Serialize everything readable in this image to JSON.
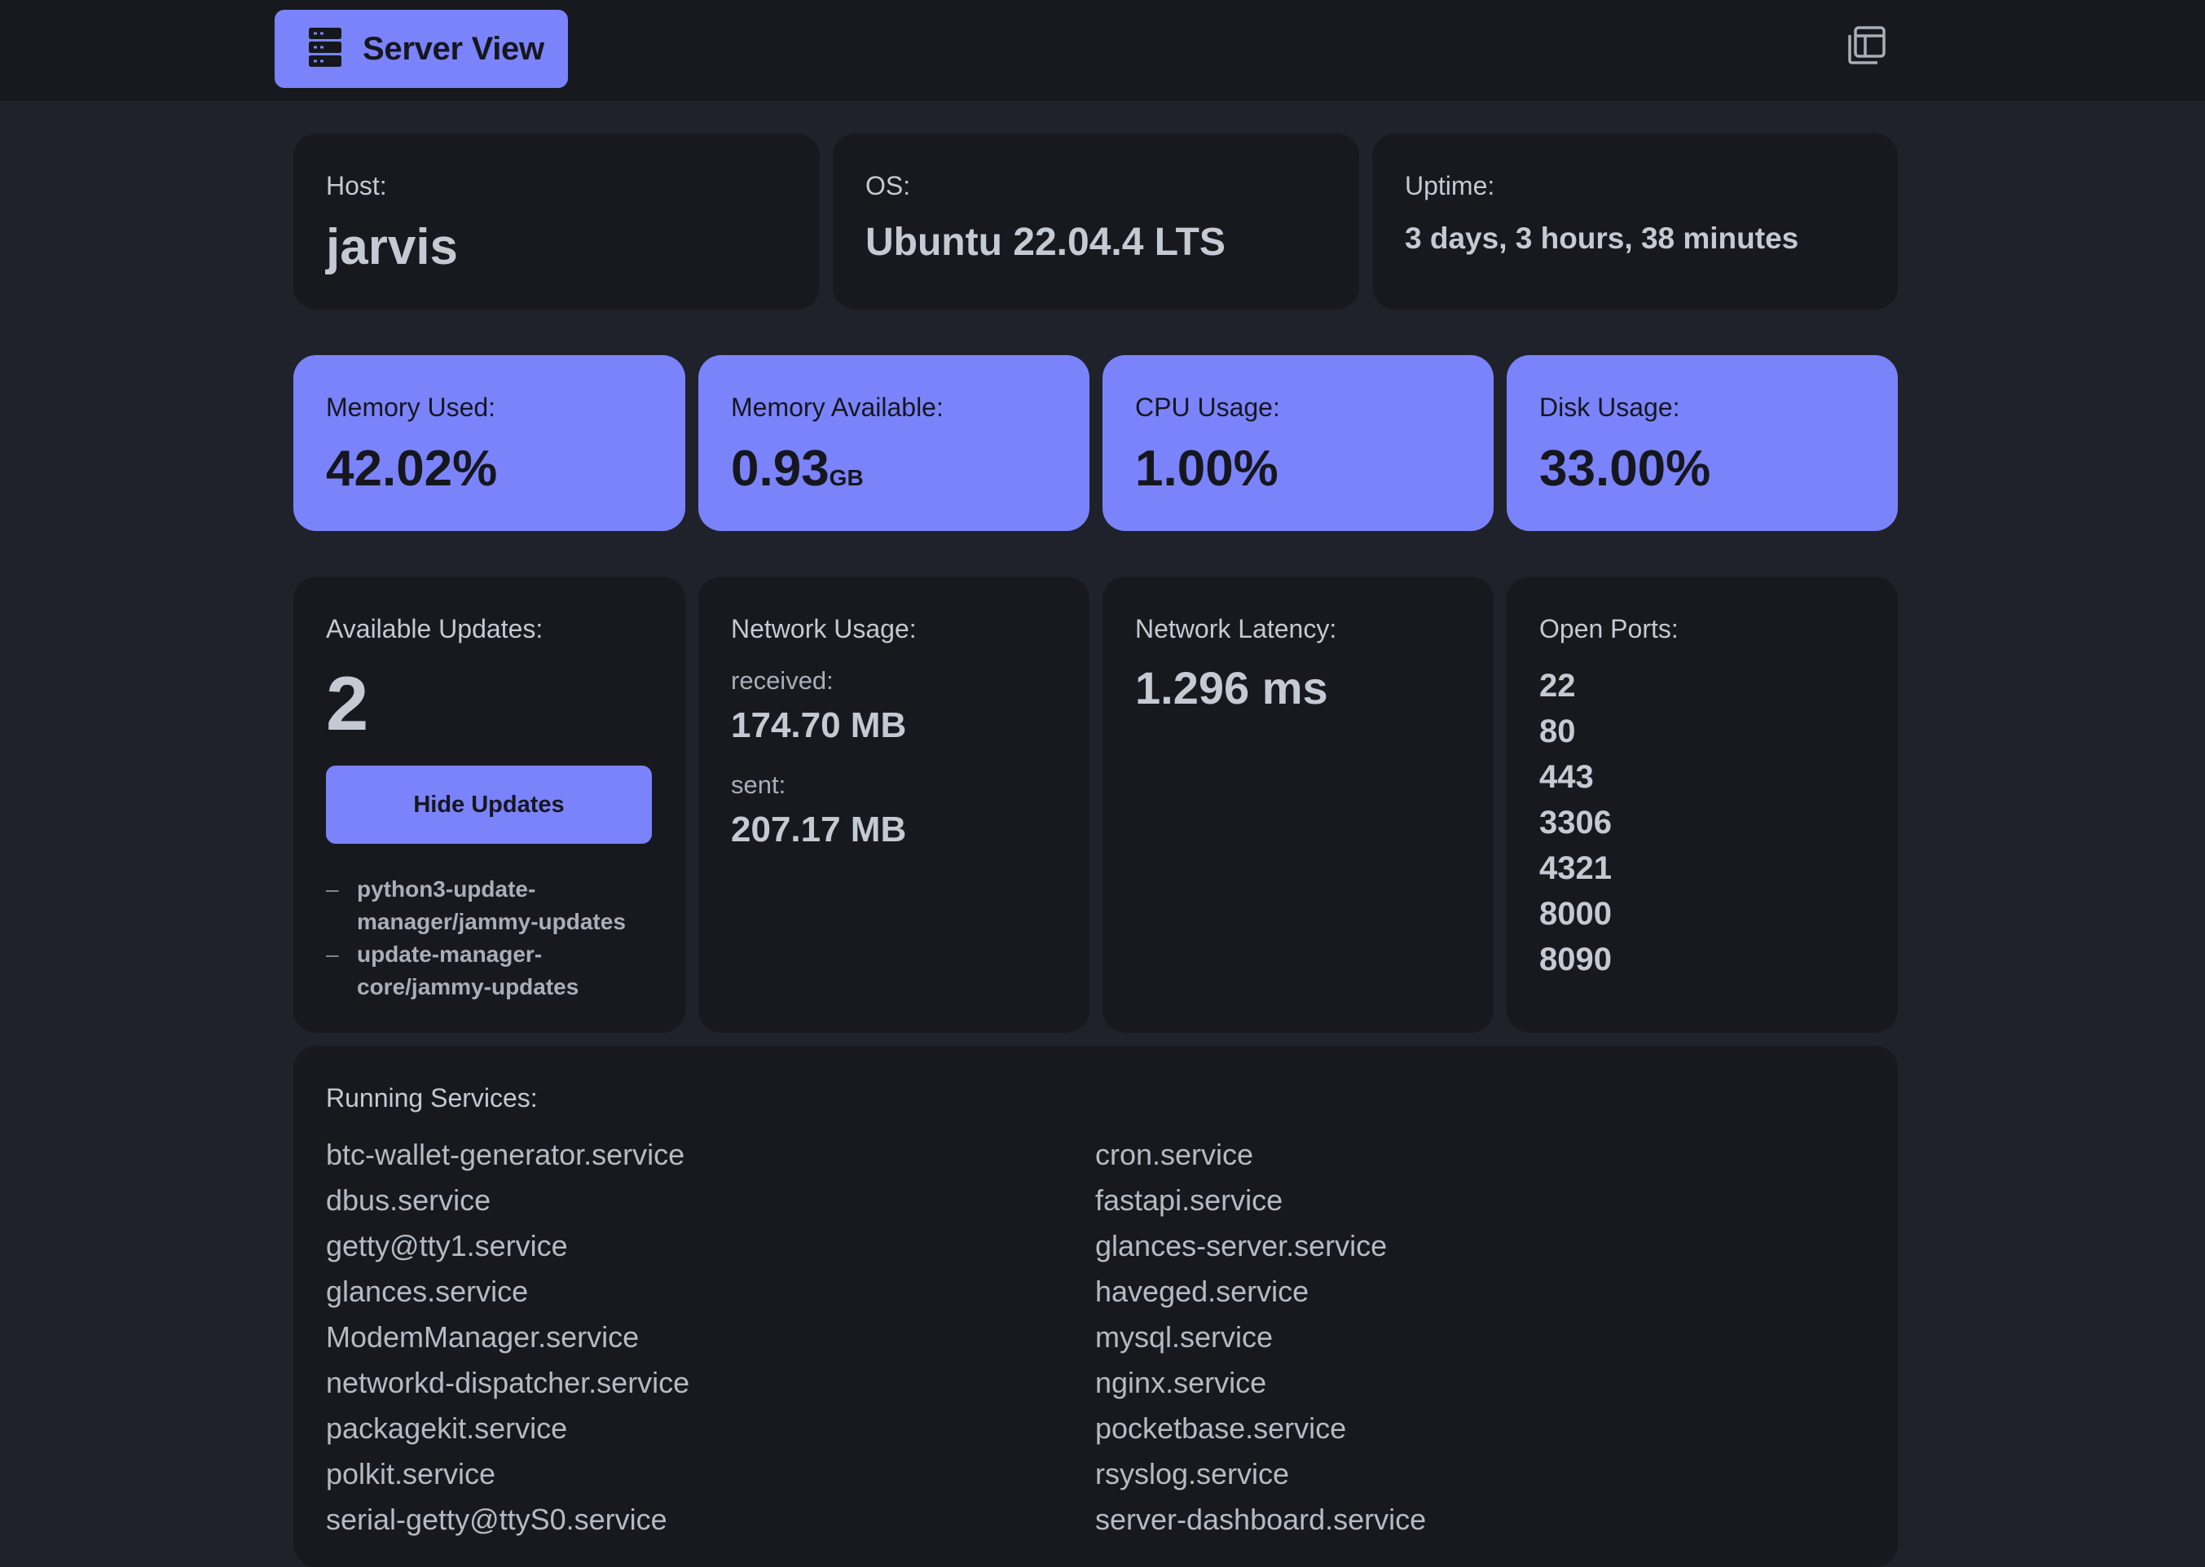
{
  "header": {
    "title": "Server View",
    "brand_icon": "server-icon",
    "window_icon": "window-restore-icon"
  },
  "colors": {
    "background": "#1f222a",
    "card": "#17191e",
    "accent": "#7b83fb",
    "text": "#c5c9d3"
  },
  "system": {
    "host_label": "Host:",
    "host_value": "jarvis",
    "os_label": "OS:",
    "os_value": "Ubuntu 22.04.4 LTS",
    "uptime_label": "Uptime:",
    "uptime_value": "3 days, 3 hours, 38 minutes"
  },
  "stats": {
    "memory_used_label": "Memory Used:",
    "memory_used_value": "42.02%",
    "memory_available_label": "Memory Available:",
    "memory_available_value": "0.93",
    "memory_available_unit": "GB",
    "cpu_label": "CPU Usage:",
    "cpu_value": "1.00%",
    "disk_label": "Disk Usage:",
    "disk_value": "33.00%"
  },
  "updates": {
    "label": "Available Updates:",
    "count": "2",
    "button_label": "Hide Updates",
    "bullet": "–",
    "items": [
      "python3-update-manager/jammy-updates",
      "update-manager-core/jammy-updates"
    ]
  },
  "network": {
    "label": "Network Usage:",
    "received_label": "received:",
    "received_value": "174.70 MB",
    "sent_label": "sent:",
    "sent_value": "207.17 MB",
    "latency_label": "Network Latency:",
    "latency_value": "1.296 ms"
  },
  "ports": {
    "label": "Open Ports:",
    "items": [
      "22",
      "80",
      "443",
      "3306",
      "4321",
      "8000",
      "8090"
    ]
  },
  "services": {
    "label": "Running Services:",
    "items": [
      "btc-wallet-generator.service",
      "cron.service",
      "dbus.service",
      "fastapi.service",
      "getty@tty1.service",
      "glances-server.service",
      "glances.service",
      "haveged.service",
      "ModemManager.service",
      "mysql.service",
      "networkd-dispatcher.service",
      "nginx.service",
      "packagekit.service",
      "pocketbase.service",
      "polkit.service",
      "rsyslog.service",
      "serial-getty@ttyS0.service",
      "server-dashboard.service"
    ]
  }
}
